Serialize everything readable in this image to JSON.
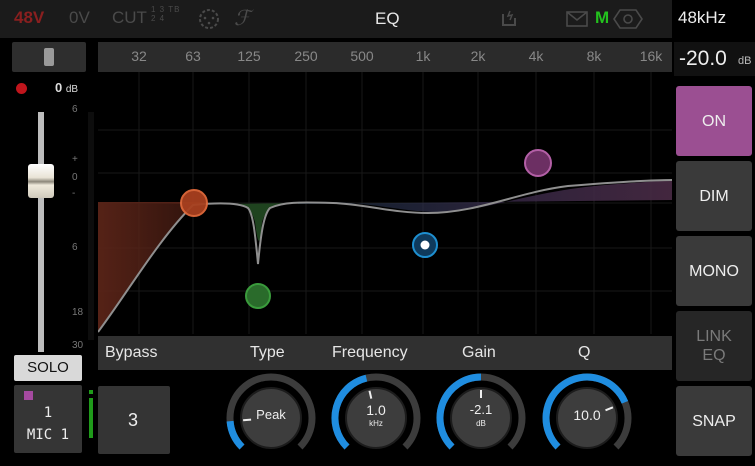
{
  "topbar": {
    "phantom": "48V",
    "zero_v": "0V",
    "cut": "CUT",
    "cut_slots": "1 3 TB\n2 4",
    "title": "EQ",
    "mute_indicator": "M",
    "sample_rate": "48kHz",
    "icons": [
      "xlr-connector-icon",
      "fx-icon",
      "io-icon",
      "mail-icon",
      "gear-icon"
    ]
  },
  "freq_axis": [
    "32",
    "63",
    "125",
    "250",
    "500",
    "1k",
    "2k",
    "4k",
    "8k",
    "16k"
  ],
  "gain_display": {
    "value": "-20.0",
    "unit": "dB"
  },
  "meter": {
    "level": "0",
    "level_unit": "dB",
    "scale": [
      "6",
      "+",
      "0",
      "-",
      "6",
      "18",
      "30"
    ]
  },
  "channel": {
    "solo": "SOLO",
    "number": "1",
    "name": "MIC 1",
    "color": "#a54aa0"
  },
  "params": {
    "labels": [
      "Bypass",
      "Type",
      "Frequency",
      "Gain",
      "Q"
    ],
    "band": "3",
    "type_value": "Peak",
    "frequency_value": "1.0",
    "frequency_unit": "kHz",
    "gain_value": "-2.1",
    "gain_unit": "dB",
    "q_value": "10.0"
  },
  "knob_levels": {
    "type": 0.15,
    "frequency": 0.45,
    "gain": 0.5,
    "q": 0.75
  },
  "right_buttons": [
    "ON",
    "DIM",
    "MONO",
    "LINK\nEQ",
    "SNAP"
  ],
  "colors": {
    "accent_on": "#9b4f92",
    "band_orange": "#e0693a",
    "band_green": "#3a9b3c",
    "band_blue": "#1e8fd0",
    "band_purple": "#b35fa6",
    "knob_arc": "#1f8de0"
  }
}
